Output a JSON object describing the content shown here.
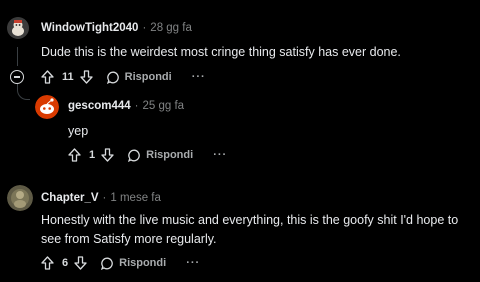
{
  "comments": [
    {
      "username": "WindowTight2040",
      "time": "28 gg fa",
      "text": "Dude this is the weirdest most cringe thing satisfy has ever done.",
      "votes": "11",
      "reply_label": "Rispondi",
      "more": "···"
    },
    {
      "username": "gescom444",
      "time": "25 gg fa",
      "text": "yep",
      "votes": "1",
      "reply_label": "Rispondi",
      "more": "···"
    },
    {
      "username": "Chapter_V",
      "time": "1 mese fa",
      "text_line1": "Honestly with the live music and everything, this is the goofy shit I'd hope to",
      "text_line2": "see from Satisfy more regularly.",
      "votes": "6",
      "reply_label": "Rispondi",
      "more": "···"
    }
  ],
  "separator": "·",
  "icons": {
    "upvote": "arrow-up-icon",
    "downvote": "arrow-down-icon",
    "reply": "chat-bubble-icon",
    "collapse": "collapse-minus-icon"
  }
}
